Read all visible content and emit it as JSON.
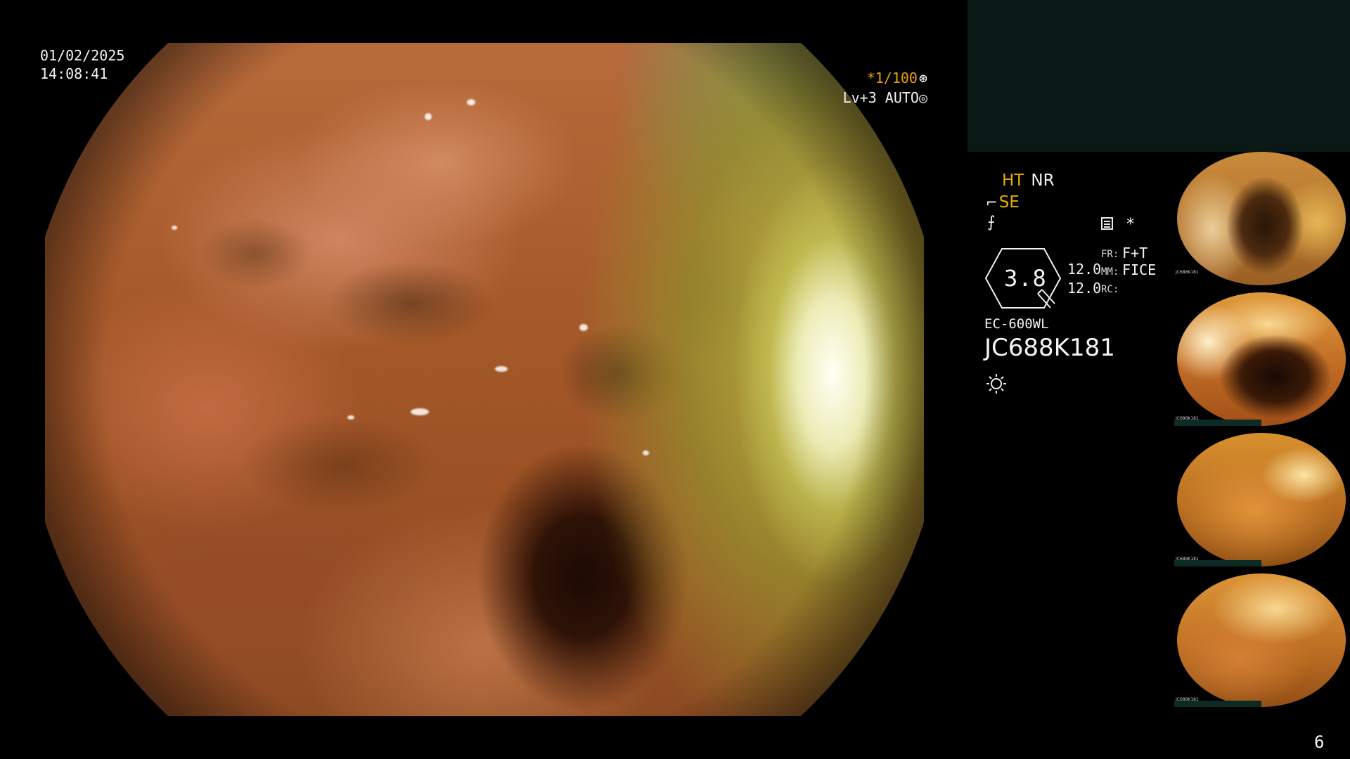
{
  "overlay": {
    "date": "01/02/2025",
    "time": "14:08:41",
    "shutter": "*1/100",
    "shutter_glyph": "⊛",
    "iris": "Lv+3 AUTO",
    "iris_glyph": "◎"
  },
  "processor": {
    "ht": "HT",
    "nr": "NR",
    "se_icon": "⌐",
    "se": "SE",
    "slash_glyph": "⨍",
    "star": "*",
    "magnification": "3.8",
    "zoom_a": "12.0",
    "zoom_b": "12.0",
    "fr_label": "FR:",
    "fr_value": "F+T",
    "mm_label": "MM:",
    "mm_value": "FICE",
    "rc_label": "RC:",
    "scope_model": "EC-600WL",
    "scope_serial": "JC688K181"
  },
  "thumbnails": [
    {
      "caption": "JC688K181"
    },
    {
      "caption": "JC688K181"
    },
    {
      "caption": "JC688K181"
    },
    {
      "caption": "JC688K181"
    }
  ],
  "page_number": "6",
  "colors": {
    "accent_orange": "#ecab00",
    "top_box": "#0a1916",
    "background": "#000000"
  },
  "icons": [
    "shutter-icon",
    "iris-icon",
    "structure-enhancement-icon",
    "slash-icon",
    "document-icon",
    "light-source-icon"
  ]
}
